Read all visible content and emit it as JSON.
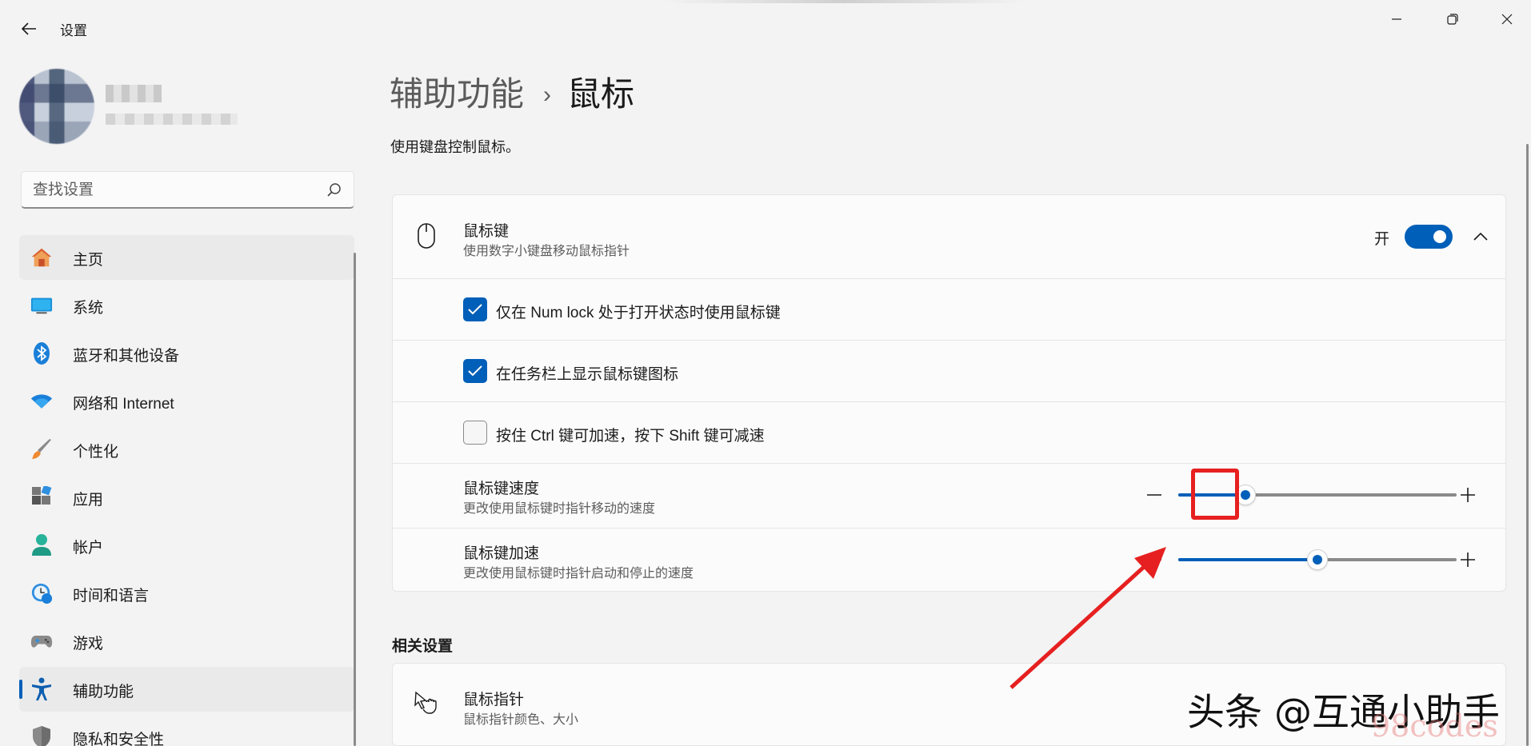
{
  "window": {
    "title": "设置"
  },
  "sidebar": {
    "search_placeholder": "查找设置",
    "items": [
      {
        "label": "主页",
        "icon": "home-icon",
        "state": "hover"
      },
      {
        "label": "系统",
        "icon": "system-icon"
      },
      {
        "label": "蓝牙和其他设备",
        "icon": "bluetooth-icon"
      },
      {
        "label": "网络和 Internet",
        "icon": "wifi-icon"
      },
      {
        "label": "个性化",
        "icon": "brush-icon"
      },
      {
        "label": "应用",
        "icon": "apps-icon"
      },
      {
        "label": "帐户",
        "icon": "account-icon"
      },
      {
        "label": "时间和语言",
        "icon": "clock-globe-icon"
      },
      {
        "label": "游戏",
        "icon": "gamepad-icon"
      },
      {
        "label": "辅助功能",
        "icon": "accessibility-icon",
        "state": "active"
      },
      {
        "label": "隐私和安全性",
        "icon": "shield-icon"
      }
    ]
  },
  "main": {
    "breadcrumb_parent": "辅助功能",
    "breadcrumb_current": "鼠标",
    "description": "使用键盘控制鼠标。",
    "mouse_keys": {
      "title": "鼠标键",
      "subtitle": "使用数字小键盘移动鼠标指针",
      "toggle_label": "开",
      "toggle_on": true,
      "options": [
        {
          "label": "仅在 Num lock 处于打开状态时使用鼠标键",
          "checked": true
        },
        {
          "label": "在任务栏上显示鼠标键图标",
          "checked": true
        },
        {
          "label": "按住 Ctrl 键可加速，按下 Shift 键可减速",
          "checked": false
        }
      ],
      "speed": {
        "title": "鼠标键速度",
        "subtitle": "更改使用鼠标键时指针移动的速度",
        "value_fraction": 0.24
      },
      "acceleration": {
        "title": "鼠标键加速",
        "subtitle": "更改使用鼠标键时指针启动和停止的速度",
        "value_fraction": 0.5
      }
    },
    "related_title": "相关设置",
    "related": {
      "title": "鼠标指针",
      "subtitle": "鼠标指针颜色、大小"
    }
  },
  "overlay": {
    "watermark": "头条 @互通小助手",
    "watermark_site": "98codes"
  },
  "colors": {
    "accent": "#005fb8",
    "annotation": "#e62020"
  }
}
